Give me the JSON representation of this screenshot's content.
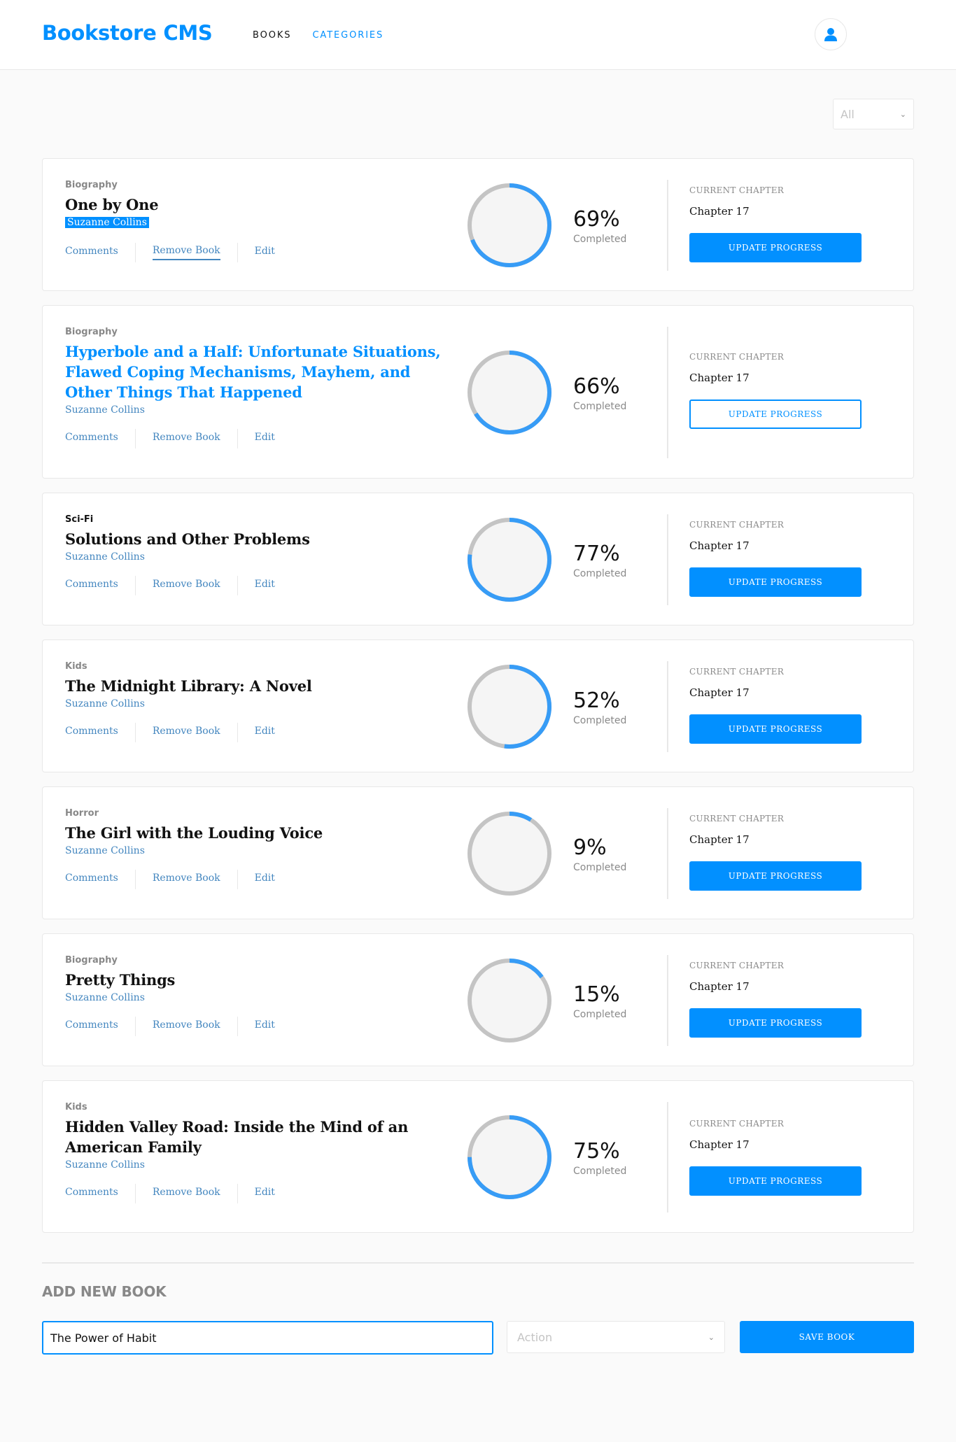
{
  "header": {
    "brand": "Bookstore CMS",
    "nav": [
      {
        "label": "BOOKS",
        "active": false
      },
      {
        "label": "CATEGORIES",
        "active": true
      }
    ],
    "user_icon": "user-icon"
  },
  "filter": {
    "selected": "All"
  },
  "books": [
    {
      "category": "Biography",
      "title": "One by One",
      "author": "Suzanne Collins",
      "progress": 69,
      "progress_text": "69%",
      "completed_label": "Completed",
      "chapter_label": "CURRENT CHAPTER",
      "chapter": "Chapter 17",
      "button": "UPDATE PROGRESS",
      "comments": "Comments",
      "remove": "Remove Book",
      "edit": "Edit"
    },
    {
      "category": "Biography",
      "title": "Hyperbole and a Half: Unfortunate Situations, Flawed Coping Mechanisms, Mayhem, and Other Things That Happened",
      "author": "Suzanne Collins",
      "progress": 66,
      "progress_text": "66%",
      "completed_label": "Completed",
      "chapter_label": "CURRENT CHAPTER",
      "chapter": "Chapter 17",
      "button": "UPDATE PROGRESS",
      "comments": "Comments",
      "remove": "Remove Book",
      "edit": "Edit"
    },
    {
      "category": "Sci-Fi",
      "title": "Solutions and Other Problems",
      "author": "Suzanne Collins",
      "progress": 77,
      "progress_text": "77%",
      "completed_label": "Completed",
      "chapter_label": "CURRENT CHAPTER",
      "chapter": "Chapter 17",
      "button": "UPDATE PROGRESS",
      "comments": "Comments",
      "remove": "Remove Book",
      "edit": "Edit"
    },
    {
      "category": "Kids",
      "title": "The Midnight Library: A Novel",
      "author": "Suzanne Collins",
      "progress": 52,
      "progress_text": "52%",
      "completed_label": "Completed",
      "chapter_label": "CURRENT CHAPTER",
      "chapter": "Chapter 17",
      "button": "UPDATE PROGRESS",
      "comments": "Comments",
      "remove": "Remove Book",
      "edit": "Edit"
    },
    {
      "category": "Horror",
      "title": "The Girl with the Louding Voice",
      "author": "Suzanne Collins",
      "progress": 9,
      "progress_text": "9%",
      "completed_label": "Completed",
      "chapter_label": "CURRENT CHAPTER",
      "chapter": "Chapter 17",
      "button": "UPDATE PROGRESS",
      "comments": "Comments",
      "remove": "Remove Book",
      "edit": "Edit"
    },
    {
      "category": "Biography",
      "title": "Pretty Things",
      "author": "Suzanne Collins",
      "progress": 15,
      "progress_text": "15%",
      "completed_label": "Completed",
      "chapter_label": "CURRENT CHAPTER",
      "chapter": "Chapter 17",
      "button": "UPDATE PROGRESS",
      "comments": "Comments",
      "remove": "Remove Book",
      "edit": "Edit"
    },
    {
      "category": "Kids",
      "title": "Hidden Valley Road: Inside the Mind of an American Family",
      "author": "Suzanne Collins",
      "progress": 75,
      "progress_text": "75%",
      "completed_label": "Completed",
      "chapter_label": "CURRENT CHAPTER",
      "chapter": "Chapter 17",
      "button": "UPDATE PROGRESS",
      "comments": "Comments",
      "remove": "Remove Book",
      "edit": "Edit"
    }
  ],
  "add_form": {
    "title": "ADD NEW BOOK",
    "input_value": "The Power of Habit",
    "action_placeholder": "Action",
    "save_label": "SAVE BOOK"
  },
  "colors": {
    "accent": "#0290ff",
    "ring_track": "#c4c4c4",
    "ring_progress": "#379cf6",
    "link": "#4386bf"
  }
}
